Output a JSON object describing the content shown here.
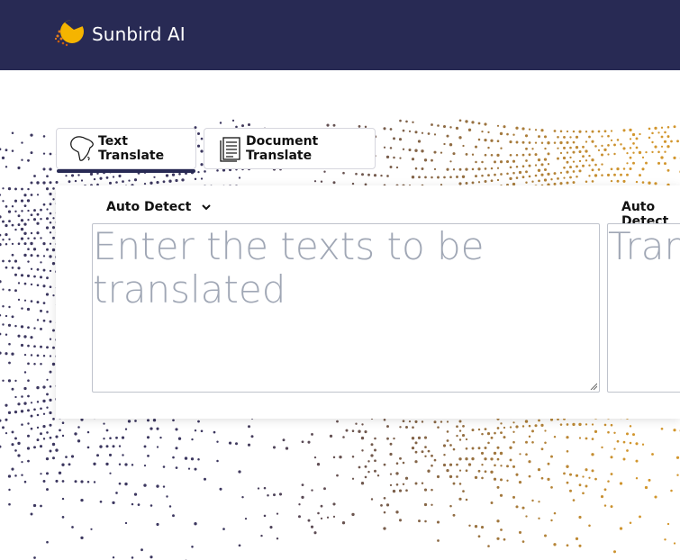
{
  "header": {
    "brand_name": "Sunbird AI",
    "background_color": "#282a54",
    "logo_icon": "sunbird-logo-icon"
  },
  "tabs": [
    {
      "label": "Text Translate",
      "icon": "africa-map-icon",
      "active": true
    },
    {
      "label": "Document Translate",
      "icon": "document-icon",
      "active": false
    }
  ],
  "translator": {
    "source_language": "Auto Detect",
    "target_language": "Auto Detect",
    "source_placeholder": "Enter the texts to be translated",
    "target_placeholder": "Translation"
  },
  "colors": {
    "accent": "#282a54",
    "logo_yellow": "#f5b400",
    "logo_orange": "#e87e1a",
    "placeholder": "#a0a7b5"
  }
}
